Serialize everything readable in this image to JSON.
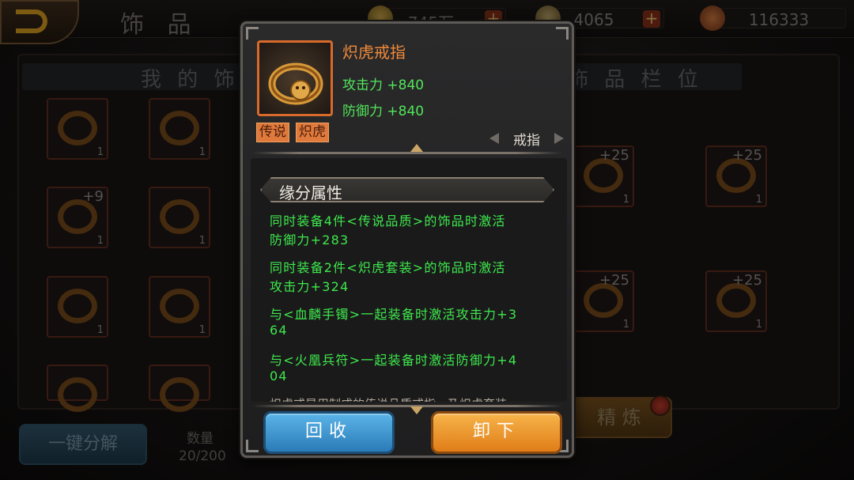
{
  "header": {
    "title": "饰 品",
    "resources": [
      {
        "icon": "gold-coin-icon",
        "value": "745万"
      },
      {
        "icon": "stamina-icon",
        "value": "4065"
      },
      {
        "icon": "gem-icon",
        "value": "116333"
      }
    ]
  },
  "background": {
    "left_section_title": "我 的 饰 品",
    "right_section_title": "饰 品 栏 位",
    "left_slots": [
      {
        "count": "1",
        "level": ""
      },
      {
        "count": "1",
        "level": ""
      },
      {
        "count": "1",
        "level": "+9"
      },
      {
        "count": "1",
        "level": ""
      },
      {
        "count": "1",
        "level": ""
      },
      {
        "count": "1",
        "level": ""
      },
      {
        "count": "",
        "level": ""
      },
      {
        "count": "",
        "level": ""
      }
    ],
    "right_slots": [
      {
        "count": "1",
        "level": "+25"
      },
      {
        "count": "1",
        "level": "+25"
      },
      {
        "count": "1",
        "level": "+25"
      },
      {
        "count": "1",
        "level": "+25"
      }
    ],
    "decompose_button": "一键分解",
    "quantity_label": "数量",
    "quantity_value": "20/200",
    "refine_button": "精 炼"
  },
  "popup": {
    "item_name": "炽虎戒指",
    "attack": "攻击力 +840",
    "defense": "防御力 +840",
    "tags": [
      "传说",
      "炽虎"
    ],
    "item_type": "戒指",
    "bond_title": "缘分属性",
    "bond_lines": [
      "同时装备4件<传说品质>的饰品时激活",
      "防御力+283",
      "同时装备2件<炽虎套装>的饰品时激活",
      "攻击力+324",
      "与<血麟手镯>一起装备时激活攻击力+3",
      "64",
      "与<火凰兵符>一起装备时激活防御力+4",
      "04"
    ],
    "bond_cut_text": "炽虎戒是用制成的传说品质戒指，乃炽虎套装",
    "recycle_button": "回收",
    "unequip_button": "卸下"
  }
}
